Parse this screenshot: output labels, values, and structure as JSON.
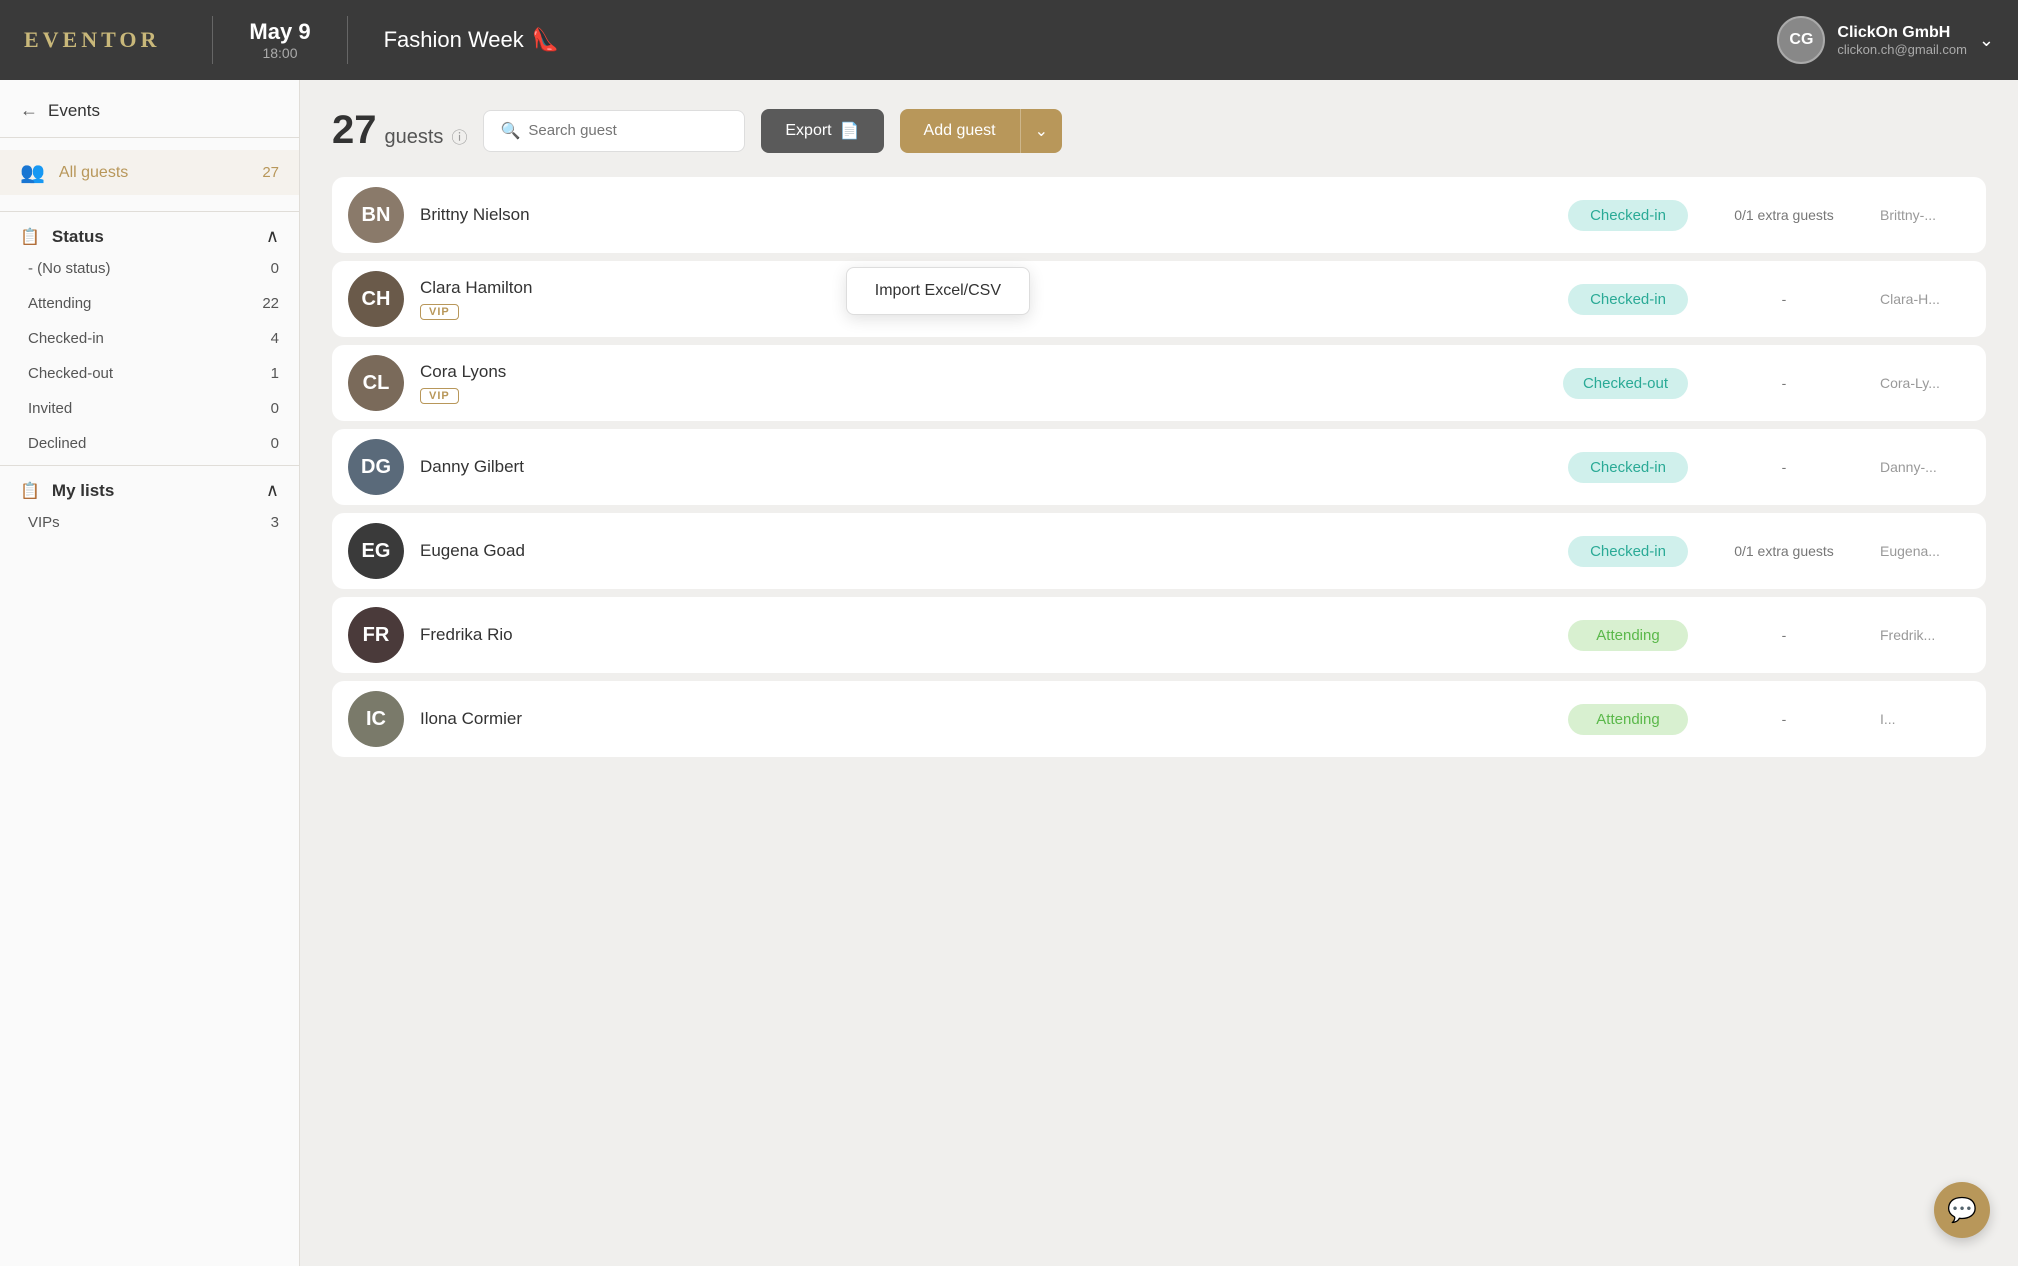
{
  "header": {
    "logo": "EVENTOR",
    "date": "May 9",
    "time": "18:00",
    "event_name": "Fashion Week",
    "event_emoji": "👠",
    "avatar_initials": "CG",
    "user_name": "ClickOn GmbH",
    "user_email": "clickon.ch@gmail.com"
  },
  "sidebar": {
    "back_label": "Events",
    "all_guests_label": "All guests",
    "all_guests_count": "27",
    "status_label": "Status",
    "status_items": [
      {
        "label": "- (No status)",
        "count": "0"
      },
      {
        "label": "Attending",
        "count": "22"
      },
      {
        "label": "Checked-in",
        "count": "4"
      },
      {
        "label": "Checked-out",
        "count": "1"
      },
      {
        "label": "Invited",
        "count": "0"
      },
      {
        "label": "Declined",
        "count": "0"
      }
    ],
    "my_lists_label": "My lists",
    "list_items": [
      {
        "label": "VIPs",
        "count": "3"
      }
    ]
  },
  "content": {
    "guest_count": "27",
    "guests_label": "guests",
    "search_placeholder": "Search guest",
    "export_label": "Export",
    "add_guest_label": "Add guest",
    "import_label": "Import Excel/CSV",
    "guests": [
      {
        "name": "Brittny Nielson",
        "vip": false,
        "status": "Checked-in",
        "status_type": "checked-in",
        "extra": "0/1 extra guests",
        "email": "Brittny-...",
        "color": "#8a7a6a"
      },
      {
        "name": "Clara Hamilton",
        "vip": true,
        "status": "Checked-in",
        "status_type": "checked-in",
        "extra": "-",
        "email": "Clara-H...",
        "color": "#6a5a4a"
      },
      {
        "name": "Cora Lyons",
        "vip": true,
        "status": "Checked-out",
        "status_type": "checked-out",
        "extra": "-",
        "email": "Cora-Ly...",
        "color": "#7a6a5a"
      },
      {
        "name": "Danny Gilbert",
        "vip": false,
        "status": "Checked-in",
        "status_type": "checked-in",
        "extra": "-",
        "email": "Danny-...",
        "color": "#5a6a7a"
      },
      {
        "name": "Eugena Goad",
        "vip": false,
        "status": "Checked-in",
        "status_type": "checked-in",
        "extra": "0/1 extra guests",
        "email": "Eugena...",
        "color": "#3a3a3a"
      },
      {
        "name": "Fredrika Rio",
        "vip": false,
        "status": "Attending",
        "status_type": "attending",
        "extra": "-",
        "email": "Fredrik...",
        "color": "#4a3a3a"
      },
      {
        "name": "Ilona Cormier",
        "vip": false,
        "status": "Attending",
        "status_type": "attending",
        "extra": "-",
        "email": "I...",
        "color": "#7a7a6a"
      }
    ]
  }
}
